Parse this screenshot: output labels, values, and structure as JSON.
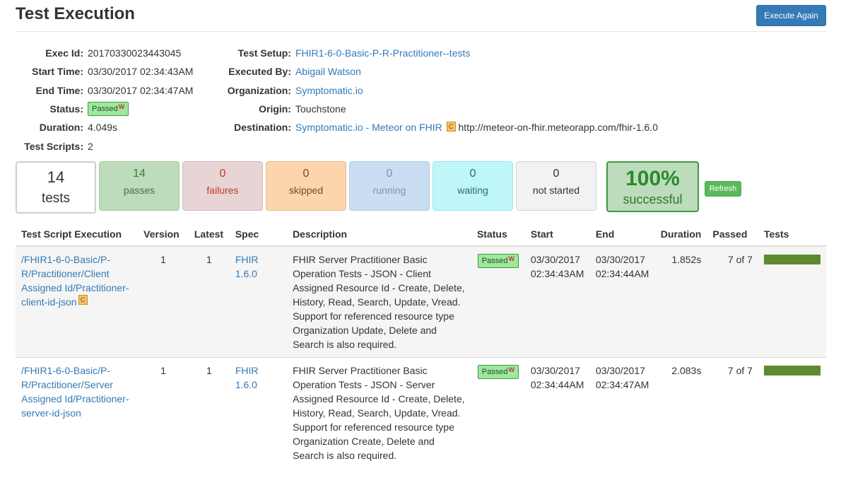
{
  "header": {
    "title": "Test Execution",
    "execute_again_label": "Execute Again"
  },
  "info_left": {
    "exec_id_label": "Exec Id:",
    "exec_id": "20170330023443045",
    "start_time_label": "Start Time:",
    "start_time": "03/30/2017 02:34:43AM",
    "end_time_label": "End Time:",
    "end_time": "03/30/2017 02:34:47AM",
    "status_label": "Status:",
    "status": "Passed",
    "status_flag": "W",
    "duration_label": "Duration:",
    "duration": "4.049s",
    "test_scripts_label": "Test Scripts:",
    "test_scripts": "2"
  },
  "info_right": {
    "test_setup_label": "Test Setup:",
    "test_setup": "FHIR1-6-0-Basic-P-R-Practitioner--tests",
    "executed_by_label": "Executed By:",
    "executed_by": "Abigail Watson",
    "organization_label": "Organization:",
    "organization": "Symptomatic.io",
    "origin_label": "Origin:",
    "origin": "Touchstone",
    "destination_label": "Destination:",
    "destination_link": "Symptomatic.io - Meteor on FHIR",
    "destination_badge": "C",
    "destination_url": "http://meteor-on-fhir.meteorapp.com/fhir-1.6.0"
  },
  "summary": {
    "tests": {
      "value": "14",
      "label": "tests"
    },
    "passes": {
      "value": "14",
      "label": "passes"
    },
    "failures": {
      "value": "0",
      "label": "failures"
    },
    "skipped": {
      "value": "0",
      "label": "skipped"
    },
    "running": {
      "value": "0",
      "label": "running"
    },
    "waiting": {
      "value": "0",
      "label": "waiting"
    },
    "not_started": {
      "value": "0",
      "label": "not started"
    },
    "success": {
      "value": "100%",
      "label": "successful"
    },
    "refresh_label": "Refresh"
  },
  "table": {
    "columns": [
      "Test Script Execution",
      "Version",
      "Latest",
      "Spec",
      "Description",
      "Status",
      "Start",
      "End",
      "Duration",
      "Passed",
      "Tests"
    ],
    "rows": [
      {
        "script": "/FHIR1-6-0-Basic/P-R/Practitioner/Client Assigned Id/Practitioner-client-id-json",
        "script_badge": "C",
        "version": "1",
        "latest": "1",
        "spec": "FHIR 1.6.0",
        "description": "FHIR Server Practitioner Basic Operation Tests - JSON - Client Assigned Resource Id - Create, Delete, History, Read, Search, Update, Vread. Support for referenced resource type Organization Update, Delete and Search is also required.",
        "status": "Passed",
        "status_flag": "W",
        "start_date": "03/30/2017",
        "start_time": "02:34:43AM",
        "end_date": "03/30/2017",
        "end_time": "02:34:44AM",
        "duration": "1.852s",
        "passed": "7 of 7",
        "progress": 1.0
      },
      {
        "script": "/FHIR1-6-0-Basic/P-R/Practitioner/Server Assigned Id/Practitioner-server-id-json",
        "script_badge": "",
        "version": "1",
        "latest": "1",
        "spec": "FHIR 1.6.0",
        "description": "FHIR Server Practitioner Basic Operation Tests - JSON - Server Assigned Resource Id - Create, Delete, History, Read, Search, Update, Vread. Support for referenced resource type Organization Create, Delete and Search is also required.",
        "status": "Passed",
        "status_flag": "W",
        "start_date": "03/30/2017",
        "start_time": "02:34:44AM",
        "end_date": "03/30/2017",
        "end_time": "02:34:47AM",
        "duration": "2.083s",
        "passed": "7 of 7",
        "progress": 1.0
      }
    ]
  }
}
